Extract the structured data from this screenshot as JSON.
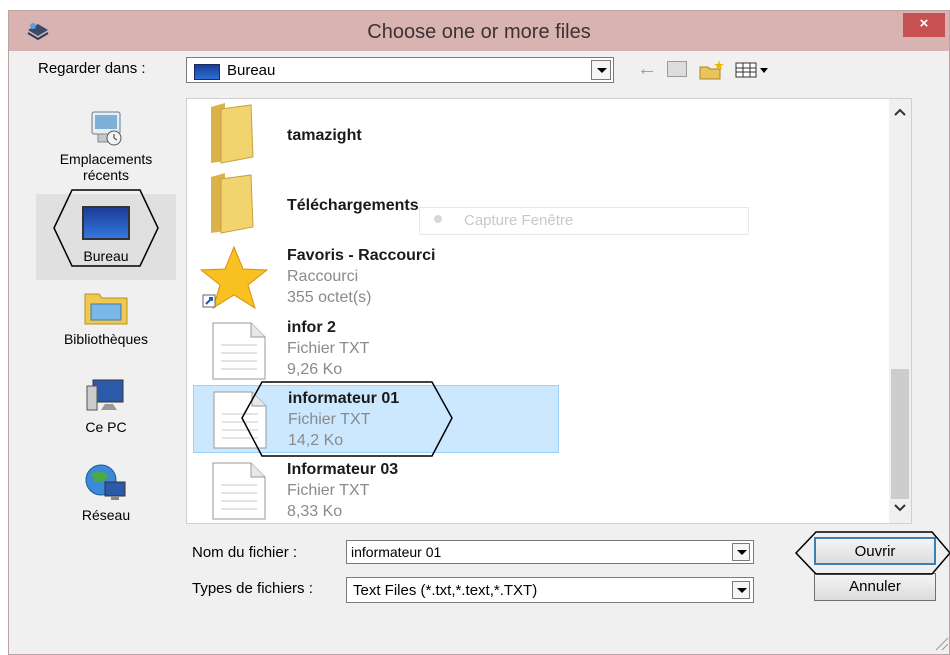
{
  "window": {
    "title": "Choose one or more files",
    "close_label": "×"
  },
  "lookin": {
    "label": "Regarder dans :",
    "value": "Bureau"
  },
  "toolbar": {
    "back_label": "←"
  },
  "places": [
    {
      "label1": "Emplacements",
      "label2": "récents",
      "icon": "recent-places-icon"
    },
    {
      "label1": "Bureau",
      "label2": "",
      "icon": "desktop-icon"
    },
    {
      "label1": "Bibliothèques",
      "label2": "",
      "icon": "libraries-icon"
    },
    {
      "label1": "Ce PC",
      "label2": "",
      "icon": "computer-icon"
    },
    {
      "label1": "Réseau",
      "label2": "",
      "icon": "network-icon"
    }
  ],
  "ghost_overlay": {
    "label": "Capture Fenêtre"
  },
  "files": [
    {
      "name": "tamazight",
      "type": "",
      "size": "",
      "icon": "folder-icon"
    },
    {
      "name": "Téléchargements",
      "type": "",
      "size": "",
      "icon": "folder-icon"
    },
    {
      "name": "Favoris - Raccourci",
      "type": "Raccourci",
      "size": "355 octet(s)",
      "icon": "star-shortcut-icon"
    },
    {
      "name": "infor 2",
      "type": "Fichier TXT",
      "size": "9,26 Ko",
      "icon": "text-file-icon"
    },
    {
      "name": "informateur 01",
      "type": "Fichier TXT",
      "size": "14,2 Ko",
      "icon": "text-file-icon",
      "selected": true
    },
    {
      "name": "Informateur 03",
      "type": "Fichier TXT",
      "size": "8,33 Ko",
      "icon": "text-file-icon"
    }
  ],
  "filename": {
    "label": "Nom du fichier :",
    "value": "informateur 01"
  },
  "filetypes": {
    "label": "Types de fichiers :",
    "value": "Text Files (*.txt,*.text,*.TXT)"
  },
  "buttons": {
    "open": "Ouvrir",
    "cancel": "Annuler"
  }
}
